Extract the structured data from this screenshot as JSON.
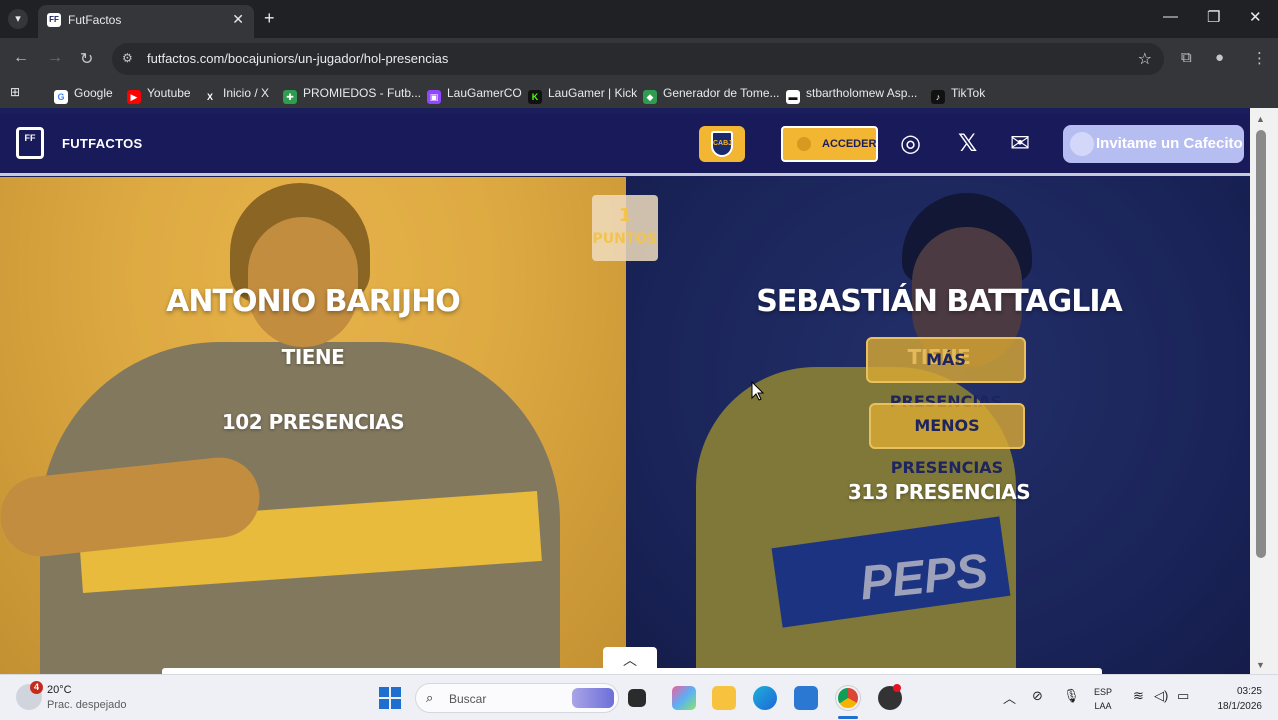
{
  "browser": {
    "tab_title": "FutFactos",
    "url": "futfactos.com/bocajuniors/un-jugador/hol-presencias",
    "bookmarks": [
      {
        "label": "Google",
        "icon": "google-icon",
        "color": "#4285f4"
      },
      {
        "label": "Youtube",
        "icon": "youtube-icon",
        "color": "#ff0000"
      },
      {
        "label": "Inicio / X",
        "icon": "x-icon",
        "color": "#000000"
      },
      {
        "label": "PROMIEDOS - Futb...",
        "icon": "promiedos-icon",
        "color": "#2e9d4f"
      },
      {
        "label": "LauGamerCO",
        "icon": "twitch-icon",
        "color": "#9146ff"
      },
      {
        "label": "LauGamer | Kick",
        "icon": "kick-icon",
        "color": "#53fc18"
      },
      {
        "label": "Generador de Tome...",
        "icon": "generator-icon",
        "color": "#2e9d4f"
      },
      {
        "label": "stbartholomew Asp...",
        "icon": "stbartholomew-icon",
        "color": "#444444"
      },
      {
        "label": "TikTok",
        "icon": "tiktok-icon",
        "color": "#111111"
      }
    ]
  },
  "site": {
    "logo_mark": "FF",
    "logo_text": "FUTFACTOS",
    "login_label": "ACCEDER",
    "cafecito_label": "Invitame un Cafecito",
    "accent_color": "#f2b632",
    "header_color": "#181a5a"
  },
  "game": {
    "score_value": "1",
    "score_label": "PUNTOS",
    "left_player": {
      "name": "ANTONIO BARIJHO",
      "verb": "TIENE",
      "stat": "102 PRESENCIAS"
    },
    "right_player": {
      "name": "SEBASTIÁN BATTAGLIA",
      "verb": "TIENE",
      "stat": "313 PRESENCIAS",
      "shirt_text": "PEPS"
    },
    "more_button": "MÁS PRESENCIAS",
    "less_button": "MENOS PRESENCIAS"
  },
  "taskbar": {
    "temperature": "20°C",
    "weather_desc": "Prac. despejado",
    "weather_badge": "4",
    "search_placeholder": "Buscar",
    "lang_top": "ESP",
    "lang_bottom": "LAA",
    "time": "03:25",
    "date": "18/1/2026"
  }
}
